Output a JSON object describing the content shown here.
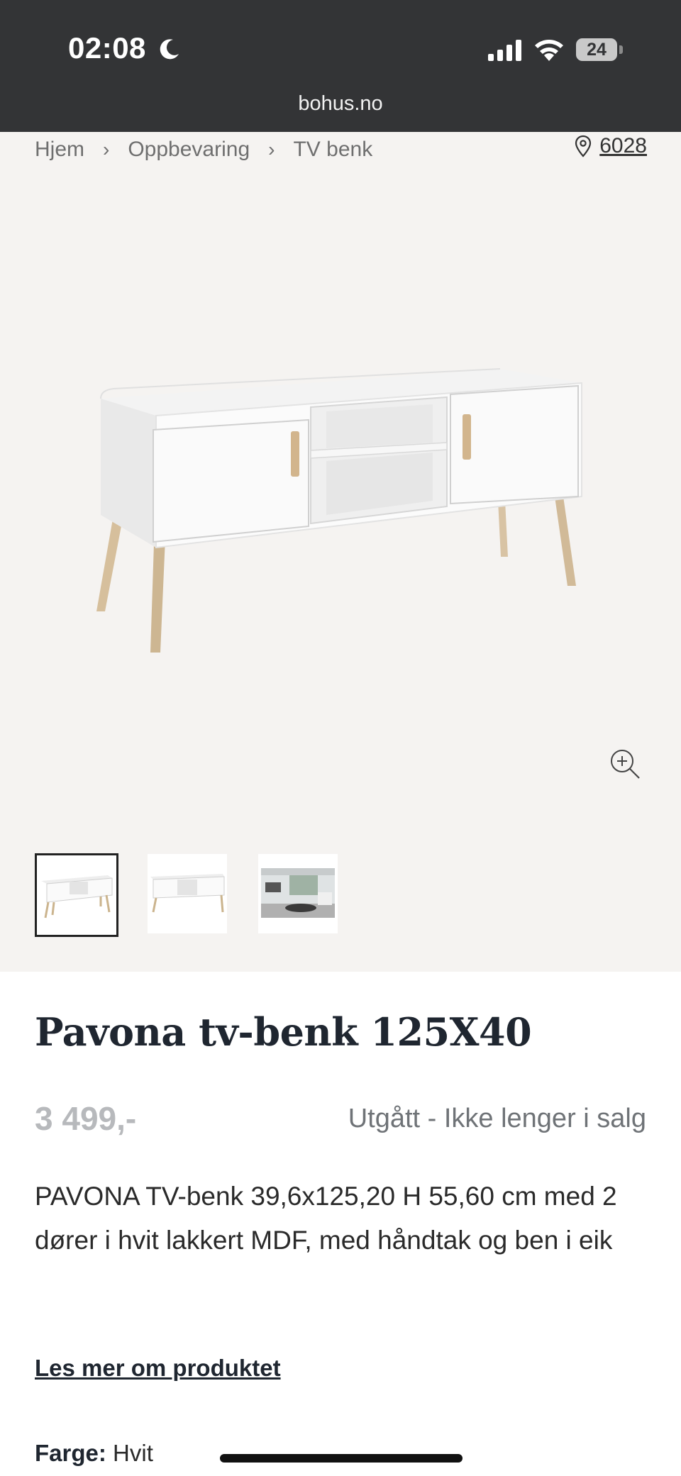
{
  "status_bar": {
    "time": "02:08",
    "battery": "24",
    "url": "bohus.no"
  },
  "breadcrumb": {
    "items": [
      "Hjem",
      "Oppbevaring",
      "TV benk"
    ],
    "separator": ">"
  },
  "store": {
    "number": "6028"
  },
  "product": {
    "title": "Pavona tv-benk 125X40",
    "price": "3 499,-",
    "availability": "Utgått - Ikke lenger i salg",
    "description": "PAVONA TV-benk 39,6x125,20 H 55,60 cm med 2 dører i hvit lakkert MDF, med håndtak og ben i eik",
    "read_more": "Les mer om produktet",
    "color_label": "Farge:",
    "color_value": "Hvit"
  },
  "icons": {
    "moon": "moon-icon",
    "signal": "signal-icon",
    "wifi": "wifi-icon",
    "battery": "battery-icon",
    "pin": "location-pin-icon",
    "zoom": "zoom-in-icon"
  },
  "colors": {
    "status_bar_bg": "#333436",
    "gallery_bg": "#f5f3f1",
    "title": "#1f2630",
    "price_muted": "#b7b9bc"
  }
}
